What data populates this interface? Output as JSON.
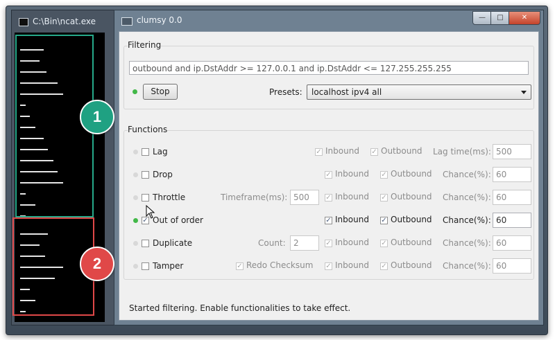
{
  "console": {
    "title": "C:\\Bin\\ncat.exe",
    "lines": [
      5,
      4,
      6,
      8,
      9,
      1,
      2,
      3,
      5,
      6,
      7,
      8,
      9,
      1,
      3,
      1
    ]
  },
  "annotations": {
    "badge1": "1",
    "badge2": "2"
  },
  "clumsy": {
    "title": "clumsy 0.0",
    "controls": {
      "minimize": "—",
      "maximize": "□",
      "close": "✕"
    },
    "filtering": {
      "label": "Filtering",
      "filter_text": "outbound and ip.DstAddr >= 127.0.0.1 and ip.DstAddr <= 127.255.255.255",
      "stop_label": "Stop",
      "presets_label": "Presets:",
      "preset_value": "localhost ipv4 all"
    },
    "functions": {
      "label": "Functions",
      "rows": [
        {
          "name": "Lag",
          "inbound": "Inbound",
          "outbound": "Outbound",
          "param_label": "Lag time(ms):",
          "param_value": "500"
        },
        {
          "name": "Drop",
          "inbound": "Inbound",
          "outbound": "Outbound",
          "param_label": "Chance(%):",
          "param_value": "60"
        },
        {
          "name": "Throttle",
          "extra_label": "Timeframe(ms):",
          "extra_value": "500",
          "inbound": "Inbound",
          "outbound": "Outbound",
          "param_label": "Chance(%):",
          "param_value": "60"
        },
        {
          "name": "Out of order",
          "inbound": "Inbound",
          "outbound": "Outbound",
          "param_label": "Chance(%):",
          "param_value": "60"
        },
        {
          "name": "Duplicate",
          "extra_label": "Count:",
          "extra_value": "2",
          "inbound": "Inbound",
          "outbound": "Outbound",
          "param_label": "Chance(%):",
          "param_value": "60"
        },
        {
          "name": "Tamper",
          "extra_label": "Redo Checksum",
          "inbound": "Inbound",
          "outbound": "Outbound",
          "param_label": "Chance(%):",
          "param_value": "60"
        }
      ]
    },
    "status": "Started filtering. Enable functionalities to take effect."
  },
  "colors": {
    "teal": "#26a98a",
    "red": "#e04848",
    "active_dot": "#42b848"
  }
}
